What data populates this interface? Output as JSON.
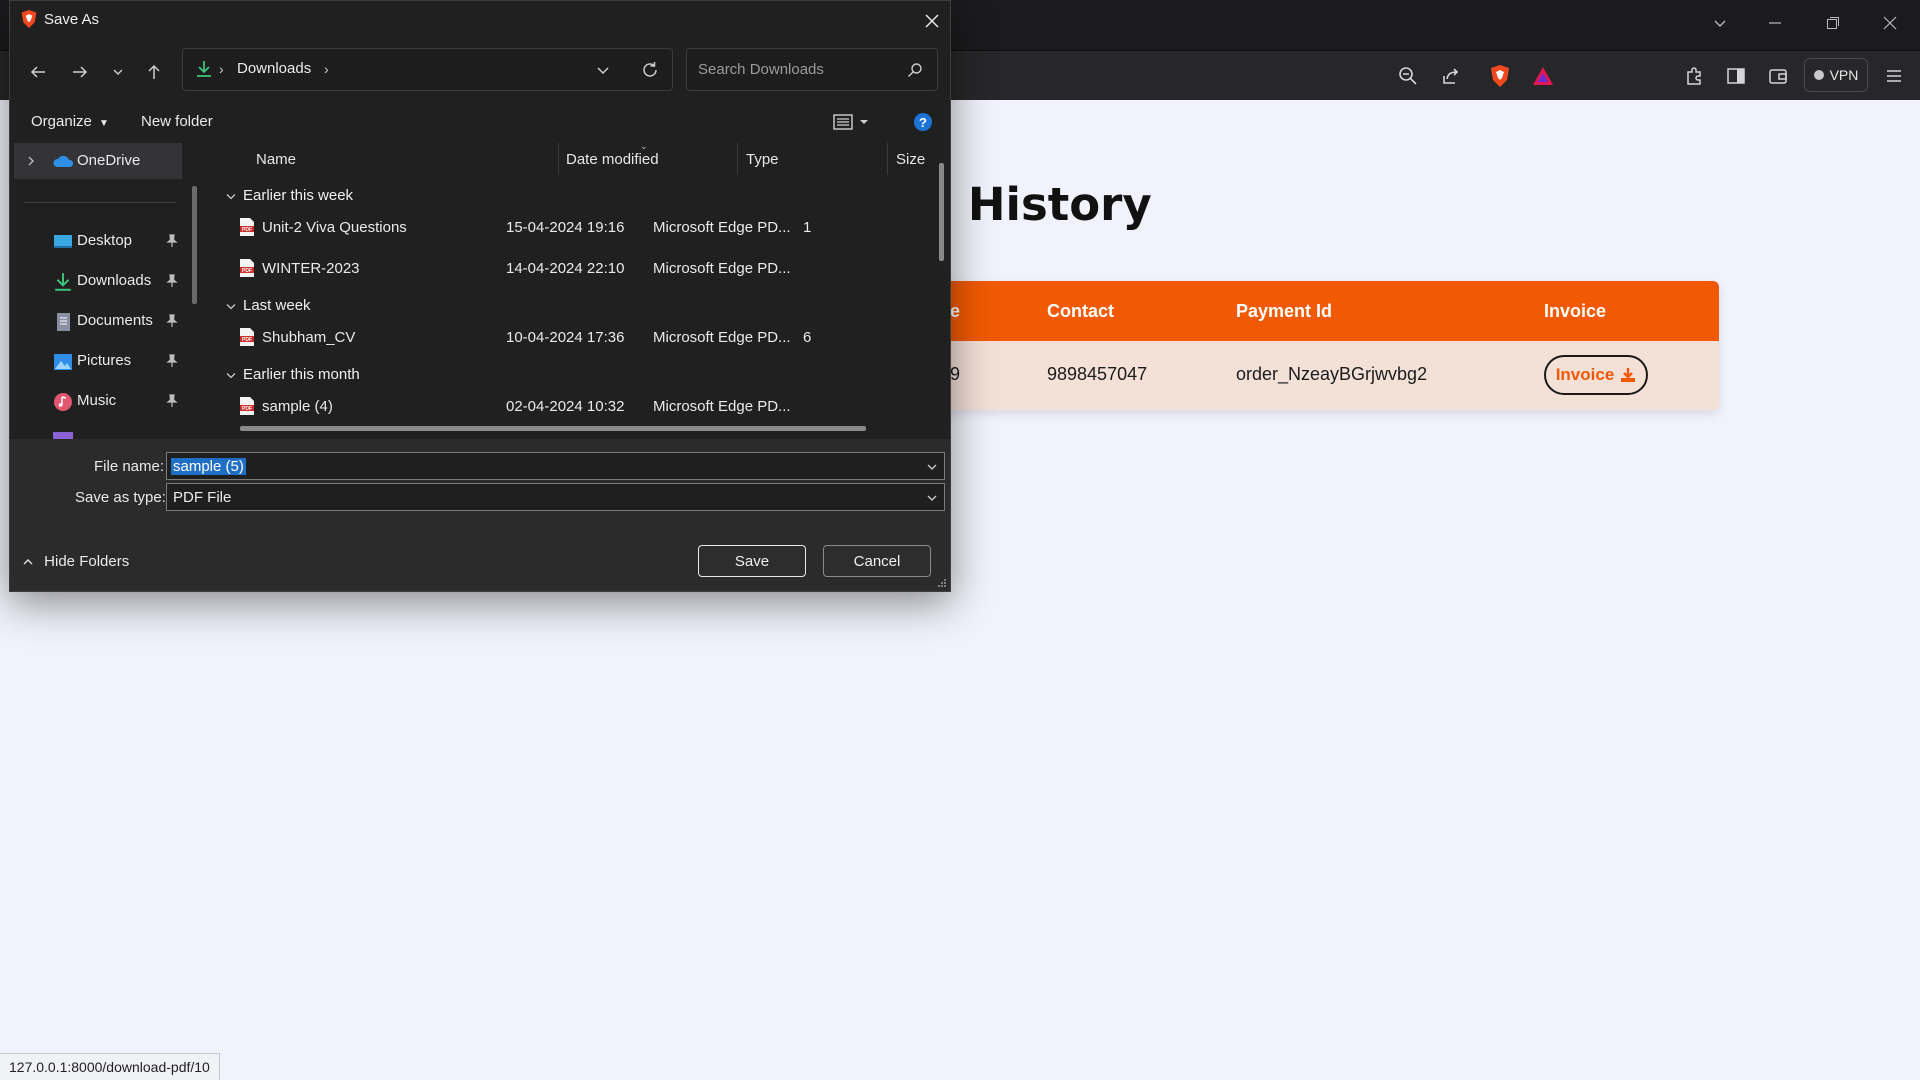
{
  "dialog": {
    "title": "Save As",
    "breadcrumb": {
      "location": "Downloads"
    },
    "search": {
      "placeholder": "Search Downloads"
    },
    "commands": {
      "organize": "Organize",
      "new_folder": "New folder"
    },
    "nav_items": [
      {
        "label": "OneDrive"
      },
      {
        "label": "Desktop"
      },
      {
        "label": "Downloads"
      },
      {
        "label": "Documents"
      },
      {
        "label": "Pictures"
      },
      {
        "label": "Music"
      }
    ],
    "columns": {
      "name": "Name",
      "date": "Date modified",
      "type": "Type",
      "size": "Size"
    },
    "groups": [
      {
        "label": "Earlier this week"
      },
      {
        "label": "Last week"
      },
      {
        "label": "Earlier this month"
      }
    ],
    "files": [
      {
        "name": "Unit-2 Viva Questions",
        "date": "15-04-2024 19:16",
        "type": "Microsoft Edge PD...",
        "size": "1"
      },
      {
        "name": "WINTER-2023",
        "date": "14-04-2024 22:10",
        "type": "Microsoft Edge PD...",
        "size": ""
      },
      {
        "name": "Shubham_CV",
        "date": "10-04-2024 17:36",
        "type": "Microsoft Edge PD...",
        "size": "6"
      },
      {
        "name": "sample (4)",
        "date": "02-04-2024 10:32",
        "type": "Microsoft Edge PD...",
        "size": ""
      }
    ],
    "file_name_label": "File name:",
    "file_name_value": "sample (5)",
    "save_type_label": "Save as type:",
    "save_type_value": "PDF File",
    "save_label": "Save",
    "cancel_label": "Cancel",
    "hide_folders_label": "Hide Folders"
  },
  "browser": {
    "vpn_label": "VPN",
    "status_url": "127.0.0.1:8000/download-pdf/10"
  },
  "page": {
    "title_visible": "g History",
    "headers": {
      "col1_partial": "e",
      "contact": "Contact",
      "payment_id": "Payment Id",
      "invoice": "Invoice"
    },
    "row": {
      "col1_partial": "9",
      "contact": "9898457047",
      "payment_id": "order_NzeayBGrjwvbg2",
      "invoice_button": "Invoice"
    }
  },
  "colors": {
    "accent_orange": "#f15a02",
    "row_bg": "#f3e0d7",
    "dialog_bg": "#202020",
    "selection_blue": "#1f6fc7"
  }
}
